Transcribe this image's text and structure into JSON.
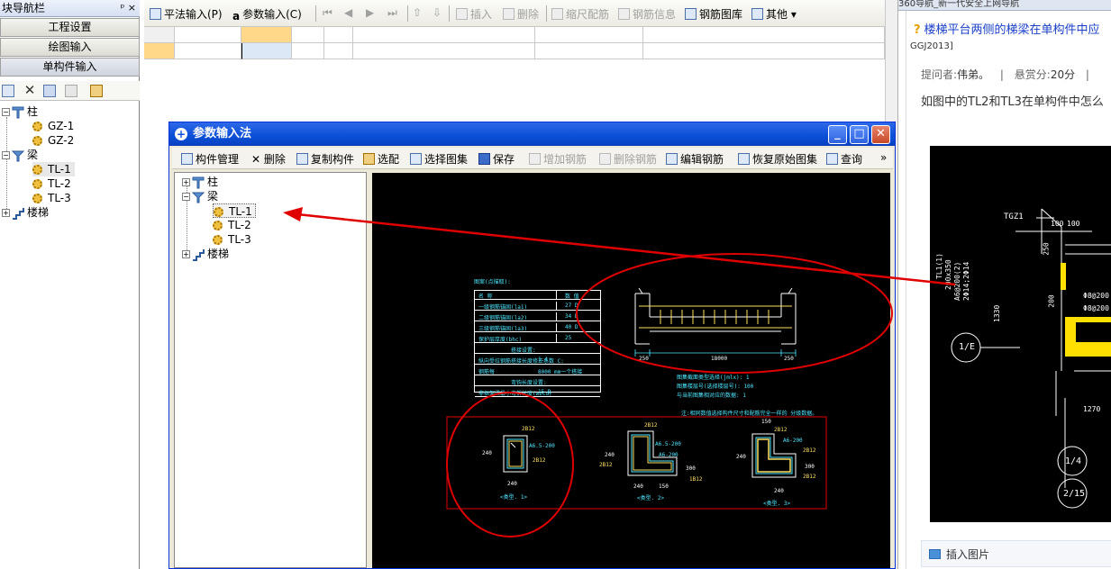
{
  "nav": {
    "title": "块导航栏",
    "controls": "ᵖ ×",
    "buttons": [
      "工程设置",
      "绘图输入",
      "单构件输入"
    ],
    "tree": [
      {
        "label": "柱",
        "children": [
          "GZ-1",
          "GZ-2"
        ]
      },
      {
        "label": "梁",
        "children": [
          "TL-1",
          "TL-2",
          "TL-3"
        ]
      },
      {
        "label": "楼梯",
        "children": []
      }
    ]
  },
  "toolbar": {
    "flat_input": "平法输入(P)",
    "param_input": "参数输入(C)",
    "insert": "插入",
    "delete": "删除",
    "scale_rebar": "缩尺配筋",
    "rebar_info": "钢筋信息",
    "rebar_library": "钢筋图库",
    "other": "其他"
  },
  "dialog": {
    "title": "参数输入法",
    "toolbar": {
      "component_mgmt": "构件管理",
      "delete": "删除",
      "copy_component": "复制构件",
      "select": "选配",
      "select_atlas": "选择图集",
      "save": "保存",
      "add_rebar": "增加钢筋",
      "remove_rebar": "删除钢筋",
      "edit_rebar": "编辑钢筋",
      "restore_atlas": "恢复原始图集",
      "query": "查询",
      "more": "»"
    },
    "tree": [
      {
        "label": "柱",
        "children": []
      },
      {
        "label": "梁",
        "children": [
          "TL-1",
          "TL-2",
          "TL-3"
        ]
      },
      {
        "label": "楼梯",
        "children": []
      }
    ],
    "cad": {
      "table_title": "图案(点描取):",
      "table_head": [
        "名 称",
        "数 值"
      ],
      "table_rows": [
        [
          "一级钢筋锚固(la1)",
          "27 D"
        ],
        [
          "二级钢筋锚固(la2)",
          "34 D"
        ],
        [
          "三级钢筋锚固(la3)",
          "40 D"
        ],
        [
          "保护层厚度(bhc)",
          "25"
        ],
        [
          "搭接设置:",
          ""
        ],
        [
          "纵向受拉钢筋搭接长度修正系数 C:",
          "1.4"
        ],
        [
          "钢筋每",
          "8000 mm一个搭接"
        ],
        [
          "弯钩长度设置:",
          ""
        ],
        [
          "非框架梁最小弯折长度(wzcd)",
          "15 D"
        ]
      ],
      "beam_dims": [
        "250",
        "18000",
        "250"
      ],
      "notes": [
        "图集截面类型选择(jmlx): 1",
        "图集楼层号(选择楼层号): 100",
        "与当前图集相对应的数据: 1"
      ],
      "note_red": "注:相同数值选择构件尺寸和配筋完全一样的 分级数据。",
      "sections": [
        {
          "label": "<类型. 1>",
          "dims": [
            "2B12",
            "A6.5-200",
            "2B12",
            "240",
            "240"
          ]
        },
        {
          "label": "<类型. 2>",
          "dims": [
            "2B12",
            "A6.5-200",
            "A6-200",
            "240",
            "2B12",
            "300",
            "240",
            "150",
            "1B12"
          ]
        },
        {
          "label": "<类型. 3>",
          "dims": [
            "150",
            "2B12",
            "A6-200",
            "2B12",
            "300",
            "240",
            "2B12",
            "240"
          ]
        }
      ]
    }
  },
  "right": {
    "tab_text": "360导航_新一代安全上网导航",
    "question_title": "楼梯平台两侧的梯梁在单构件中应",
    "sub": "GGJ2013]",
    "asker_label": "提问者:",
    "asker": "伟弟。",
    "bounty_label": "悬赏分:",
    "bounty": "20分",
    "body": "如图中的TL2和TL3在单构件中怎么",
    "cad": [
      "TGZ1",
      "100",
      "100",
      "250",
      "200",
      "TL1(1)",
      "200x350",
      "A6@200(2)",
      "2Φ14;2Φ14",
      "1330",
      "1/E",
      "Φ8@200",
      "Φ8@200",
      "1270",
      "1/4",
      "2/15"
    ],
    "insert_image": "插入图片"
  },
  "colors": {
    "title_blue": "#0a4fd6",
    "annotation_red": "#e00000",
    "grid_highlight": "#ffd88a"
  }
}
